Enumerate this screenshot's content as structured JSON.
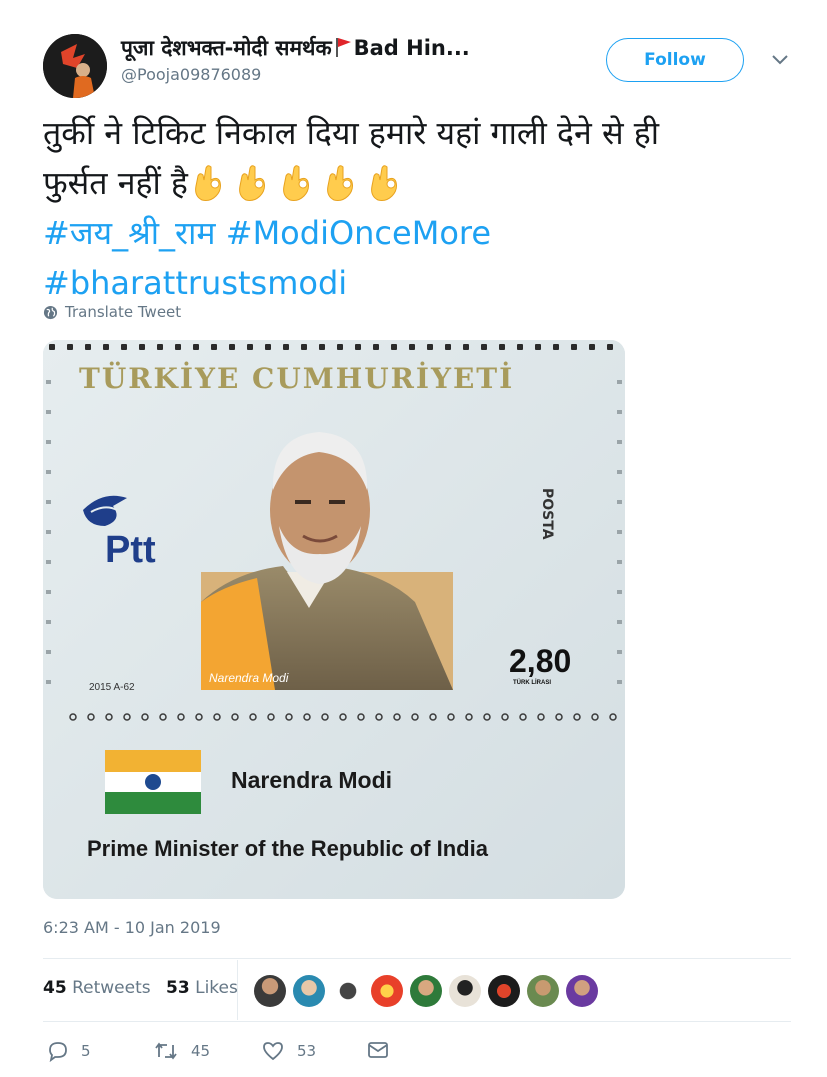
{
  "user": {
    "display_name_prefix": "पूजा देशभक्त-मोदी समर्थक",
    "display_name_suffix": "Bad Hin...",
    "handle": "@Pooja09876089"
  },
  "follow_label": "Follow",
  "tweet": {
    "line1": "तुर्की ने टिकिट निकाल दिया हमारे यहां गाली देने से ही",
    "line2": "फुर्सत नहीं है",
    "hashtag1": "#जय_श्री_राम",
    "hashtag2": "#ModiOnceMore",
    "hashtag3": "#bharattrustsmodi"
  },
  "translate_label": "Translate Tweet",
  "stamp": {
    "country": "TÜRKİYE CUMHURİYETİ",
    "postal_logo": "Ptt",
    "posta": "POSTA",
    "portrait_caption": "Narendra Modi",
    "value": "2,80",
    "currency": "TÜRK LİRASI",
    "code": "2015 A-62",
    "name": "Narendra Modi",
    "title": "Prime Minister of the Republic of India"
  },
  "timestamp": "6:23 AM - 10 Jan 2019",
  "stats": {
    "retweets_count": "45",
    "retweets_label": "Retweets",
    "likes_count": "53",
    "likes_label": "Likes"
  },
  "actions": {
    "reply_count": "5",
    "retweet_count": "45",
    "like_count": "53"
  },
  "colors": {
    "accent": "#1da1f2",
    "muted": "#657786"
  },
  "icons": [
    "flag-icon",
    "ok-hand-icon",
    "chevron-down-icon",
    "globe-icon",
    "reply-icon",
    "retweet-icon",
    "heart-icon",
    "mail-icon"
  ]
}
